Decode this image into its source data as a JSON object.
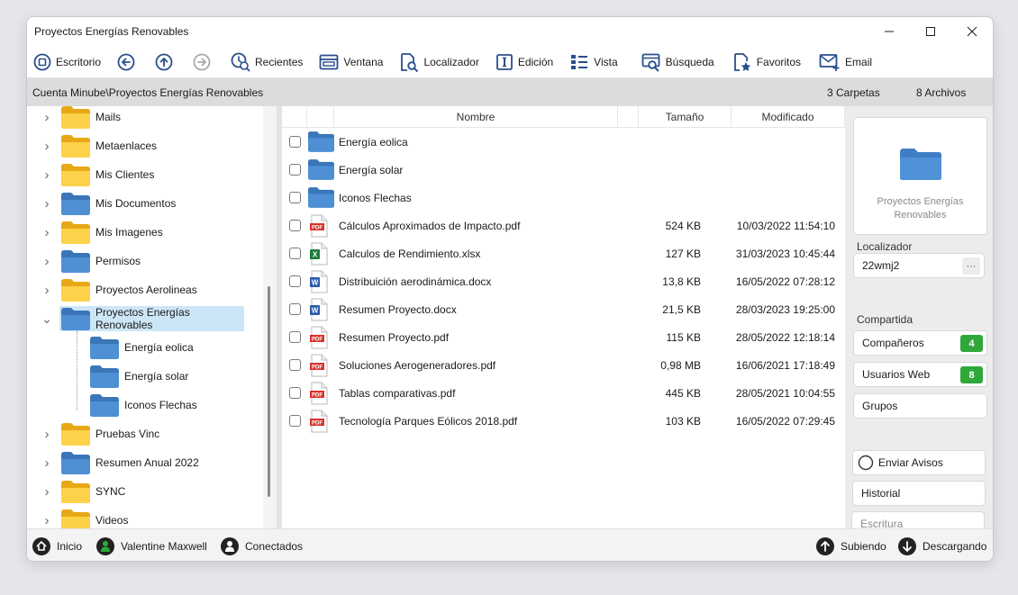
{
  "window": {
    "title": "Proyectos Energías Renovables"
  },
  "toolbar": {
    "escritorio": "Escritorio",
    "recientes": "Recientes",
    "ventana": "Ventana",
    "localizador": "Localizador",
    "edicion": "Edición",
    "vista": "Vista",
    "busqueda": "Búsqueda",
    "favoritos": "Favoritos",
    "email": "Email"
  },
  "pathbar": {
    "path": "Cuenta Minube\\Proyectos Energías Renovables",
    "folders": "3 Carpetas",
    "files": "8 Archivos"
  },
  "tree": {
    "items": [
      {
        "label": "Mails",
        "color": "yellow"
      },
      {
        "label": "Metaenlaces",
        "color": "yellow"
      },
      {
        "label": "Mis Clientes",
        "color": "yellow"
      },
      {
        "label": "Mis Documentos",
        "color": "blue"
      },
      {
        "label": "Mis Imagenes",
        "color": "yellow"
      },
      {
        "label": "Permisos",
        "color": "blue"
      },
      {
        "label": "Proyectos Aerolineas",
        "color": "yellow"
      },
      {
        "label": "Proyectos Energías Renovables",
        "color": "blue",
        "selected": true
      },
      {
        "label": "Energía eolica",
        "color": "blue",
        "child": true
      },
      {
        "label": "Energía solar",
        "color": "blue",
        "child": true
      },
      {
        "label": "Iconos Flechas",
        "color": "blue",
        "child": true
      },
      {
        "label": "Pruebas Vinc",
        "color": "yellow"
      },
      {
        "label": "Resumen Anual 2022",
        "color": "blue"
      },
      {
        "label": "SYNC",
        "color": "yellow"
      },
      {
        "label": "Videos",
        "color": "yellow"
      }
    ]
  },
  "filelist": {
    "headers": {
      "name": "Nombre",
      "size": "Tamaño",
      "modified": "Modificado"
    },
    "rows": [
      {
        "name": "Energía eolica",
        "type": "folder",
        "size": "",
        "modified": ""
      },
      {
        "name": "Energía solar",
        "type": "folder",
        "size": "",
        "modified": ""
      },
      {
        "name": "Iconos Flechas",
        "type": "folder",
        "size": "",
        "modified": ""
      },
      {
        "name": "Cálculos Aproximados de Impacto.pdf",
        "type": "pdf",
        "size": "524 KB",
        "modified": "10/03/2022 11:54:10"
      },
      {
        "name": "Calculos de Rendimiento.xlsx",
        "type": "xlsx",
        "size": "127 KB",
        "modified": "31/03/2023 10:45:44"
      },
      {
        "name": "Distribuición aerodinámica.docx",
        "type": "docx",
        "size": "13,8 KB",
        "modified": "16/05/2022 07:28:12"
      },
      {
        "name": "Resumen Proyecto.docx",
        "type": "docx",
        "size": "21,5 KB",
        "modified": "28/03/2023 19:25:00"
      },
      {
        "name": "Resumen Proyecto.pdf",
        "type": "pdf",
        "size": "115 KB",
        "modified": "28/05/2022 12:18:14"
      },
      {
        "name": "Soluciones Aerogeneradores.pdf",
        "type": "pdf",
        "size": "0,98 MB",
        "modified": "16/06/2021 17:18:49"
      },
      {
        "name": "Tablas comparativas.pdf",
        "type": "pdf",
        "size": "445 KB",
        "modified": "28/05/2021 10:04:55"
      },
      {
        "name": "Tecnología Parques Eólicos 2018.pdf",
        "type": "pdf",
        "size": "103 KB",
        "modified": "16/05/2022 07:29:45"
      }
    ]
  },
  "sidepanel": {
    "preview_name": "Proyectos Energías Renovables",
    "localizador_label": "Localizador",
    "localizador_value": "22wmj2",
    "localizador_more": "···",
    "compartida_label": "Compartida",
    "companeros": "Compañeros",
    "companeros_count": "4",
    "usuarios_web": "Usuarios Web",
    "usuarios_web_count": "8",
    "grupos": "Grupos",
    "enviar_avisos": "Enviar Avisos",
    "historial": "Historial",
    "escritura": "Escritura"
  },
  "statusbar": {
    "inicio": "Inicio",
    "user": "Valentine Maxwell",
    "conectados": "Conectados",
    "subiendo": "Subiendo",
    "descargando": "Descargando"
  },
  "colors": {
    "accent": "#2a4e8c",
    "folder_blue": "#4a86c8",
    "folder_yellow": "#f5c43a",
    "badge_green": "#2fa83a",
    "selection": "#cde6f7",
    "pdf_red": "#d9322b",
    "excel_green": "#1f7a3f",
    "word_blue": "#2b5bab"
  }
}
